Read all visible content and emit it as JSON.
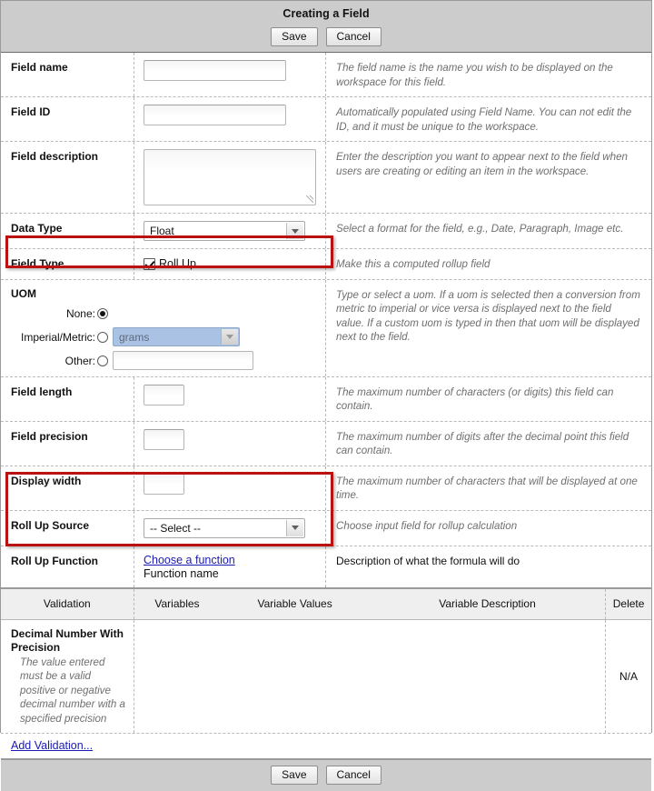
{
  "header": {
    "title": "Creating a Field",
    "save_label": "Save",
    "cancel_label": "Cancel"
  },
  "footer": {
    "save_label": "Save",
    "cancel_label": "Cancel"
  },
  "form": {
    "field_name": {
      "label": "Field name",
      "value": "",
      "help": "The field name is the name you wish to be displayed on the workspace for this field."
    },
    "field_id": {
      "label": "Field ID",
      "value": "",
      "help": "Automatically populated using Field Name. You can not edit the ID, and it must be unique to the workspace."
    },
    "field_description": {
      "label": "Field description",
      "value": "",
      "help": "Enter the description you want to appear next to the field when users are creating or editing an item in the workspace."
    },
    "data_type": {
      "label": "Data Type",
      "value": "Float",
      "help": "Select a format for the field, e.g., Date, Paragraph, Image etc."
    },
    "field_type": {
      "label": "Field Type",
      "checkbox_label": "Roll Up",
      "checked": true,
      "help": "Make this a computed rollup field"
    },
    "uom": {
      "label": "UOM",
      "none_label": "None:",
      "imperial_metric_label": "Imperial/Metric:",
      "other_label": "Other:",
      "selected": "none",
      "unit_value": "grams",
      "other_value": "",
      "help": "Type or select a uom. If a uom is selected then a conversion from metric to imperial or vice versa is displayed next to the field value. If a custom uom is typed in then that uom will be displayed next to the field."
    },
    "field_length": {
      "label": "Field length",
      "value": "",
      "help": "The maximum number of characters (or digits) this field can contain."
    },
    "field_precision": {
      "label": "Field precision",
      "value": "",
      "help": "The maximum number of digits after the decimal point this field can contain."
    },
    "display_width": {
      "label": "Display width",
      "value": "",
      "help": "The maximum number of characters that will be displayed at one time."
    },
    "rollup_source": {
      "label": "Roll Up Source",
      "value": "-- Select --",
      "help": "Choose input field for rollup calculation"
    },
    "rollup_function": {
      "label": "Roll Up Function",
      "link_label": "Choose a function",
      "function_name": "Function name",
      "help": "Description of what the formula will do"
    }
  },
  "validation_table": {
    "columns": [
      "Validation",
      "Variables",
      "Variable Values",
      "Variable Description",
      "Delete"
    ],
    "rows": [
      {
        "validation_title": "Decimal Number With Precision",
        "validation_desc": "The value entered must be a valid positive or negative decimal number with a specified precision",
        "variables": "",
        "variable_values": "",
        "variable_description": "",
        "delete": "N/A"
      }
    ],
    "add_link": "Add Validation..."
  },
  "highlights": {
    "accent_color": "#bb1111"
  }
}
